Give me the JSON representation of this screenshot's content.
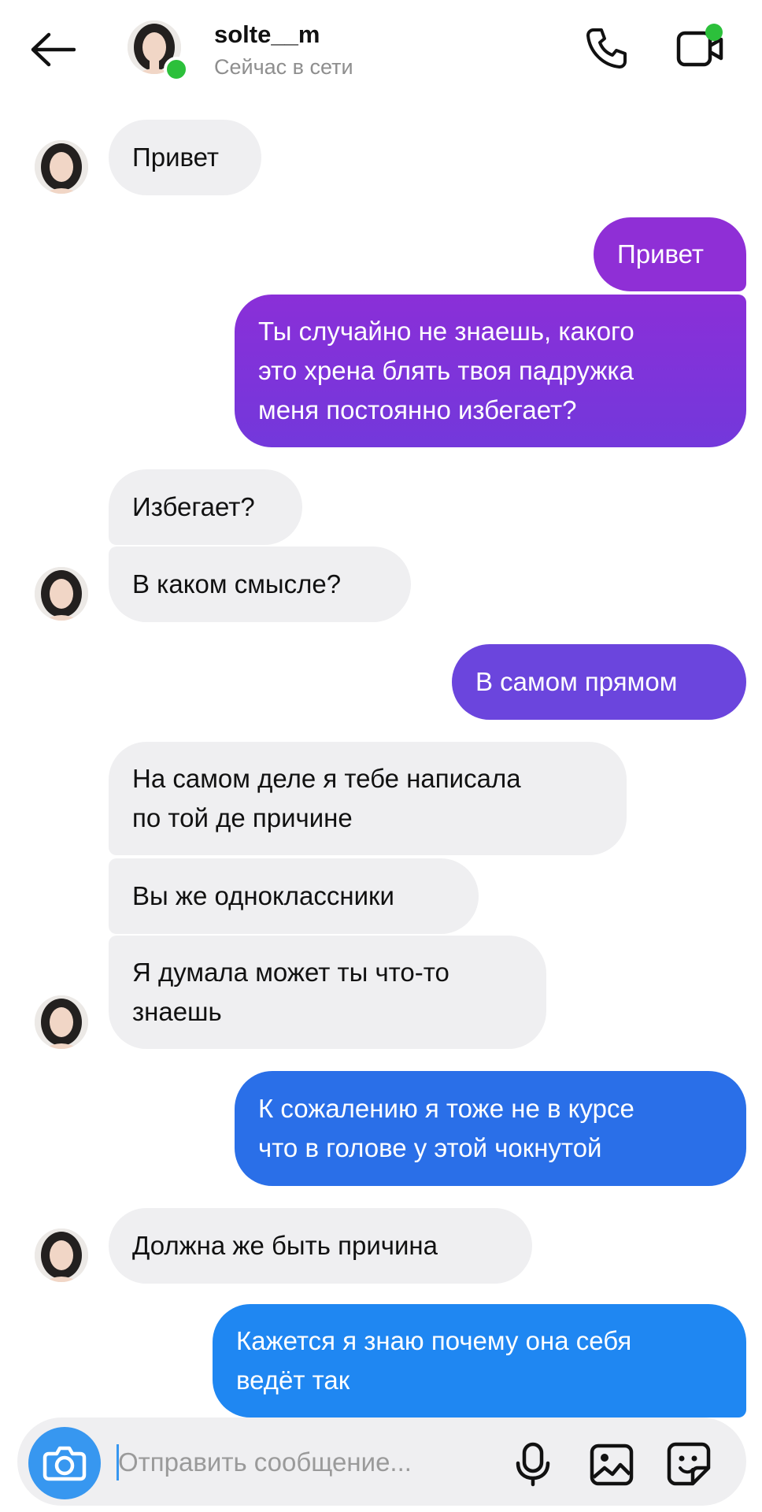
{
  "header": {
    "username": "solte__m",
    "status": "Сейчас в сети",
    "icons": {
      "back": "arrow-left-icon",
      "call": "phone-icon",
      "video": "video-call-icon",
      "online": "online-indicator"
    }
  },
  "messages": [
    {
      "sender": "them",
      "text": "Привет"
    },
    {
      "sender": "me",
      "text": "Привет"
    },
    {
      "sender": "me",
      "text": "Ты случайно не знаешь, какого\nэто хрена блять твоя падружка\nменя постоянно избегает?"
    },
    {
      "sender": "them",
      "text": "Избегает?"
    },
    {
      "sender": "them",
      "text": "В каком смысле?"
    },
    {
      "sender": "me",
      "text": "В самом прямом"
    },
    {
      "sender": "them",
      "text": "На самом деле я тебе написала\nпо той де причине"
    },
    {
      "sender": "them",
      "text": "Вы же одноклассники"
    },
    {
      "sender": "them",
      "text": "Я думала может ты что-то\nзнаешь"
    },
    {
      "sender": "me",
      "text": "К сожалению я тоже не в курсе\nчто в голове у этой чокнутой"
    },
    {
      "sender": "them",
      "text": "Должна же быть причина"
    },
    {
      "sender": "me",
      "text": "Кажется я знаю почему она себя\nведёт так"
    }
  ],
  "composer": {
    "placeholder": "Отправить сообщение...",
    "icons": [
      "camera-icon",
      "microphone-icon",
      "gallery-icon",
      "sticker-icon"
    ]
  },
  "colors": {
    "incoming_bubble": "#efeff1",
    "outgoing_purple": "#8f2fd6",
    "outgoing_violet": "#6b45dd",
    "outgoing_blue": "#2a6fe8",
    "outgoing_light_blue": "#1f87f2",
    "online": "#2cc03b",
    "camera_button": "#3797f0"
  }
}
